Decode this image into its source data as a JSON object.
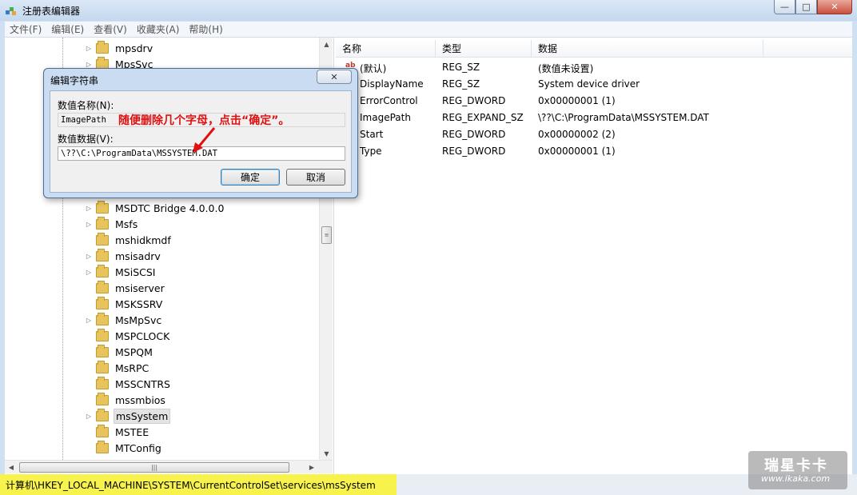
{
  "window": {
    "title": "注册表编辑器",
    "controls": {
      "minimize": "—",
      "maximize": "□",
      "close": "✕"
    }
  },
  "menu": [
    "文件(F)",
    "编辑(E)",
    "查看(V)",
    "收藏夹(A)",
    "帮助(H)"
  ],
  "tree": {
    "top_rows": [
      {
        "label": "mpsdrv",
        "expandable": true
      },
      {
        "label": "MpsSvc",
        "expandable": true
      }
    ],
    "rows": [
      {
        "label": "MSDTC Bridge 4.0.0.0",
        "expandable": true
      },
      {
        "label": "Msfs",
        "expandable": true
      },
      {
        "label": "mshidkmdf",
        "expandable": false
      },
      {
        "label": "msisadrv",
        "expandable": true
      },
      {
        "label": "MSiSCSI",
        "expandable": true
      },
      {
        "label": "msiserver",
        "expandable": false
      },
      {
        "label": "MSKSSRV",
        "expandable": false
      },
      {
        "label": "MsMpSvc",
        "expandable": true
      },
      {
        "label": "MSPCLOCK",
        "expandable": false
      },
      {
        "label": "MSPQM",
        "expandable": false
      },
      {
        "label": "MsRPC",
        "expandable": false
      },
      {
        "label": "MSSCNTRS",
        "expandable": false
      },
      {
        "label": "mssmbios",
        "expandable": false
      },
      {
        "label": "msSystem",
        "expandable": true,
        "selected": true
      },
      {
        "label": "MSTEE",
        "expandable": false
      },
      {
        "label": "MTConfig",
        "expandable": false
      }
    ]
  },
  "values": {
    "headers": [
      "名称",
      "类型",
      "数据"
    ],
    "rows": [
      {
        "name": "(默认)",
        "type": "REG_SZ",
        "data": "(数值未设置)"
      },
      {
        "name": "DisplayName",
        "type": "REG_SZ",
        "data": "System device driver"
      },
      {
        "name": "ErrorControl",
        "type": "REG_DWORD",
        "data": "0x00000001 (1)"
      },
      {
        "name": "ImagePath",
        "type": "REG_EXPAND_SZ",
        "data": "\\??\\C:\\ProgramData\\MSSYSTEM.DAT"
      },
      {
        "name": "Start",
        "type": "REG_DWORD",
        "data": "0x00000002 (2)"
      },
      {
        "name": "Type",
        "type": "REG_DWORD",
        "data": "0x00000001 (1)"
      }
    ]
  },
  "status": {
    "path": "计算机\\HKEY_LOCAL_MACHINE\\SYSTEM\\CurrentControlSet\\services\\msSystem",
    "highlight_color": "#f7f34c"
  },
  "dialog": {
    "title": "编辑字符串",
    "close": "✕",
    "name_label": "数值名称(N):",
    "name_value": "ImagePath",
    "data_label": "数值数据(V):",
    "data_value": "\\??\\C:\\ProgramData\\MSSYSTEM.DAT",
    "ok": "确定",
    "cancel": "取消"
  },
  "annotation": {
    "text": "随便删除几个字母，点击“确定”。",
    "color": "#e01010"
  },
  "watermark": {
    "brand": "瑞星卡卡",
    "url": "www.ikaka.com"
  }
}
